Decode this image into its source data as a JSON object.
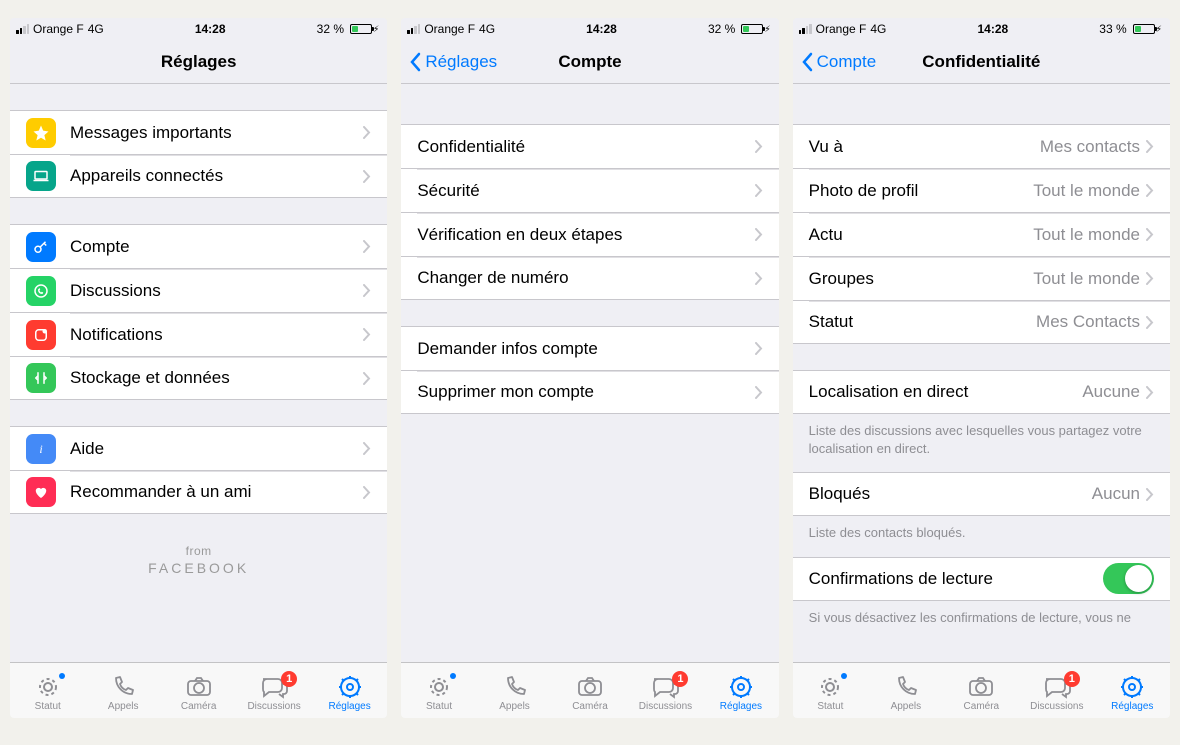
{
  "screens": [
    {
      "status": {
        "carrier": "Orange F",
        "net": "4G",
        "time": "14:28",
        "battery": "32 %"
      },
      "nav": {
        "title": "Réglages",
        "back": null
      },
      "footer": {
        "from": "from",
        "fb": "FACEBOOK"
      }
    },
    {
      "status": {
        "carrier": "Orange F",
        "net": "4G",
        "time": "14:28",
        "battery": "32 %"
      },
      "nav": {
        "title": "Compte",
        "back": "Réglages"
      }
    },
    {
      "status": {
        "carrier": "Orange F",
        "net": "4G",
        "time": "14:28",
        "battery": "33 %"
      },
      "nav": {
        "title": "Confidentialité",
        "back": "Compte"
      }
    }
  ],
  "s1": {
    "g1": [
      {
        "label": "Messages importants",
        "icon": "star"
      },
      {
        "label": "Appareils connectés",
        "icon": "laptop"
      }
    ],
    "g2": [
      {
        "label": "Compte",
        "icon": "key"
      },
      {
        "label": "Discussions",
        "icon": "whats"
      },
      {
        "label": "Notifications",
        "icon": "notif"
      },
      {
        "label": "Stockage et données",
        "icon": "storage"
      }
    ],
    "g3": [
      {
        "label": "Aide",
        "icon": "info"
      },
      {
        "label": "Recommander à un ami",
        "icon": "heart"
      }
    ]
  },
  "s2": {
    "g1": [
      {
        "label": "Confidentialité"
      },
      {
        "label": "Sécurité"
      },
      {
        "label": "Vérification en deux étapes"
      },
      {
        "label": "Changer de numéro"
      }
    ],
    "g2": [
      {
        "label": "Demander infos compte"
      },
      {
        "label": "Supprimer mon compte"
      }
    ]
  },
  "s3": {
    "g1": [
      {
        "label": "Vu à",
        "detail": "Mes contacts"
      },
      {
        "label": "Photo de profil",
        "detail": "Tout le monde"
      },
      {
        "label": "Actu",
        "detail": "Tout le monde"
      },
      {
        "label": "Groupes",
        "detail": "Tout le monde"
      },
      {
        "label": "Statut",
        "detail": "Mes Contacts"
      }
    ],
    "g2": [
      {
        "label": "Localisation en direct",
        "detail": "Aucune"
      }
    ],
    "g2_footer": "Liste des discussions avec lesquelles vous partagez votre localisation en direct.",
    "g3": [
      {
        "label": "Bloqués",
        "detail": "Aucun"
      }
    ],
    "g3_footer": "Liste des contacts bloqués.",
    "g4": [
      {
        "label": "Confirmations de lecture",
        "switch": true
      }
    ],
    "g4_footer": "Si vous désactivez les confirmations de lecture, vous ne"
  },
  "tabbar": {
    "items": [
      {
        "label": "Statut",
        "name": "statut",
        "dot": true
      },
      {
        "label": "Appels",
        "name": "appels"
      },
      {
        "label": "Caméra",
        "name": "camera"
      },
      {
        "label": "Discussions",
        "name": "discussions",
        "badge": "1"
      },
      {
        "label": "Réglages",
        "name": "reglages",
        "active": true
      }
    ]
  }
}
